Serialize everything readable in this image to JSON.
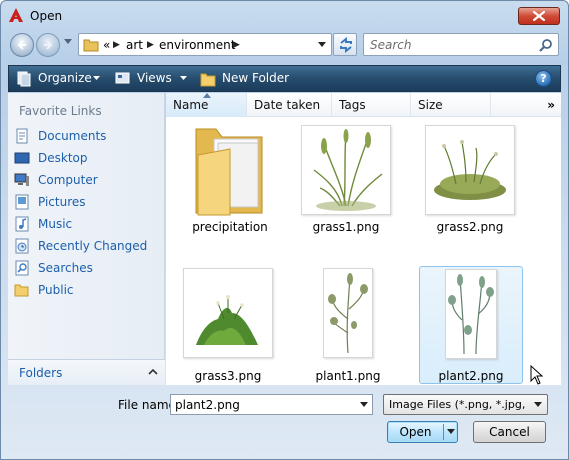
{
  "window": {
    "title": "Open",
    "accent": "#1c3c5b"
  },
  "address": {
    "overflow": "«",
    "parts": [
      "art",
      "environment"
    ]
  },
  "search": {
    "placeholder": "Search"
  },
  "toolbar": {
    "organize": "Organize",
    "views": "Views",
    "new_folder": "New Folder",
    "help": "?"
  },
  "sidebar": {
    "header": "Favorite Links",
    "items": [
      {
        "label": "Documents",
        "icon": "documents-icon"
      },
      {
        "label": "Desktop",
        "icon": "desktop-icon"
      },
      {
        "label": "Computer",
        "icon": "computer-icon"
      },
      {
        "label": "Pictures",
        "icon": "pictures-icon"
      },
      {
        "label": "Music",
        "icon": "music-icon"
      },
      {
        "label": "Recently Changed",
        "icon": "recently-changed-icon"
      },
      {
        "label": "Searches",
        "icon": "searches-icon"
      },
      {
        "label": "Public",
        "icon": "public-folder-icon"
      }
    ],
    "folders_label": "Folders"
  },
  "columns": [
    "Name",
    "Date taken",
    "Tags",
    "Size"
  ],
  "columns_more": "»",
  "files": [
    {
      "name": "precipitation",
      "kind": "folder"
    },
    {
      "name": "grass1.png",
      "kind": "image"
    },
    {
      "name": "grass2.png",
      "kind": "image"
    },
    {
      "name": "grass3.png",
      "kind": "image"
    },
    {
      "name": "plant1.png",
      "kind": "image"
    },
    {
      "name": "plant2.png",
      "kind": "image",
      "selected": true
    }
  ],
  "footer": {
    "file_name_label": "File name:",
    "file_name_value": "plant2.png",
    "filter_value": "Image Files (*.png, *.jpg, *.dds",
    "open_label": "Open",
    "cancel_label": "Cancel"
  }
}
